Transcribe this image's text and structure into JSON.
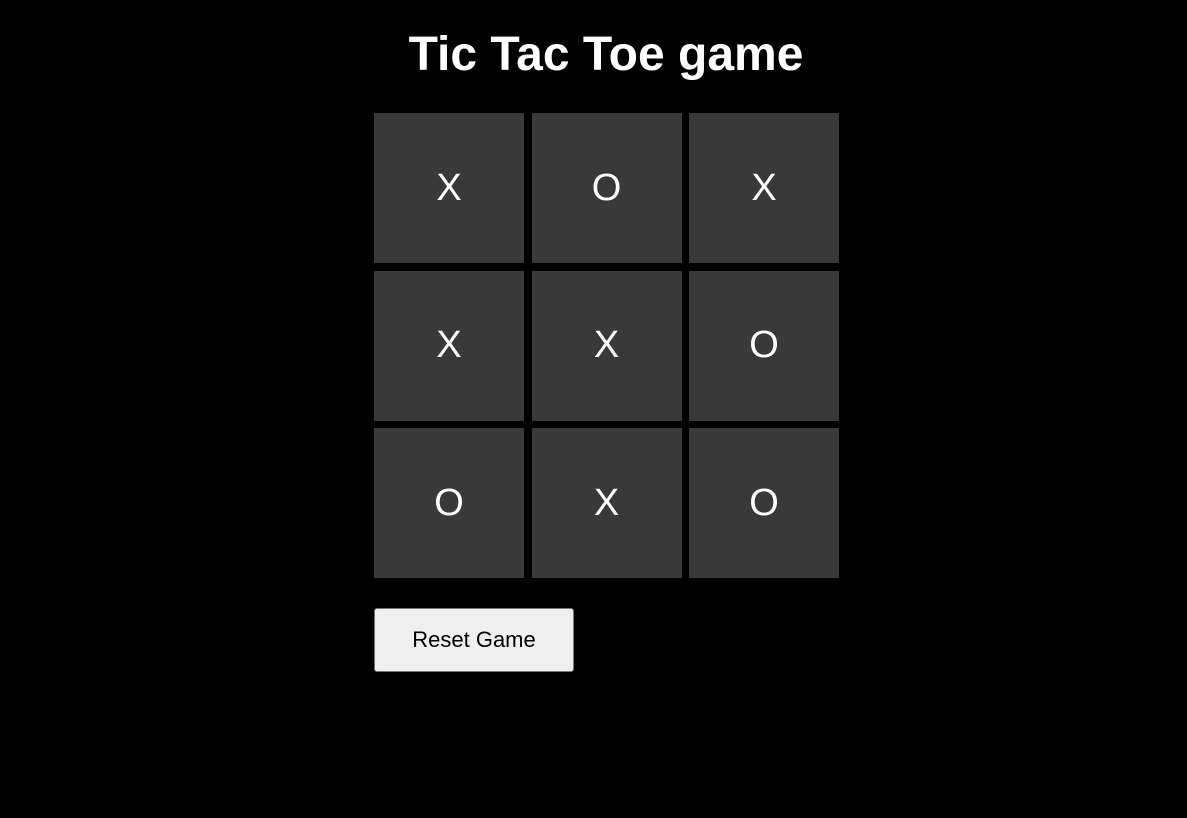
{
  "game": {
    "title": "Tic Tac Toe game",
    "board": [
      [
        "X",
        "O",
        "X"
      ],
      [
        "X",
        "X",
        "O"
      ],
      [
        "O",
        "X",
        "O"
      ]
    ],
    "reset_label": "Reset Game"
  },
  "colors": {
    "background": "#000000",
    "cell": "#3a3939",
    "mark": "#ffffff",
    "button": "#efefef"
  }
}
